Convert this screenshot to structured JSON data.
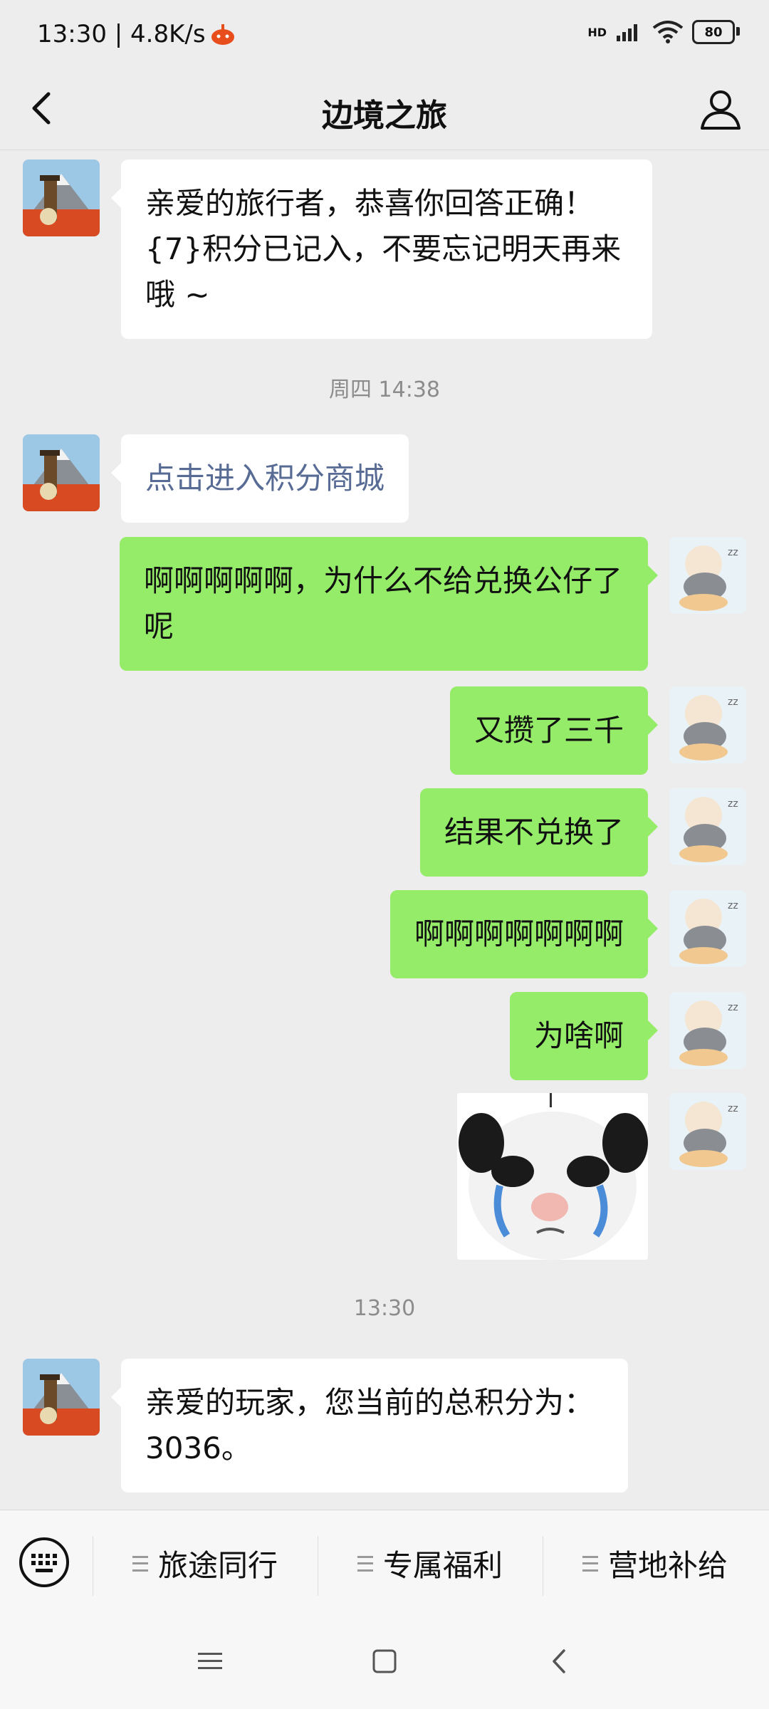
{
  "status_bar": {
    "time_speed": "13:30 | 4.8K/s",
    "network": "HD",
    "battery": "80"
  },
  "header": {
    "title": "边境之旅",
    "back_icon": "chevron-left-icon",
    "profile_icon": "person-icon"
  },
  "messages": {
    "m1": "亲爱的旅行者，恭喜你回答正确！{7}积分已记入，不要忘记明天再来哦 ~",
    "ts1": "周四 14:38",
    "m2_link": "点击进入积分商城",
    "m3": "啊啊啊啊啊，为什么不给兑换公仔了呢",
    "m4": "又攒了三千",
    "m5": "结果不兑换了",
    "m6": "啊啊啊啊啊啊啊",
    "m7": "为啥啊",
    "ts2": "13:30",
    "m9": "亲爱的玩家，您当前的总积分为：3036。"
  },
  "bottom_menu": {
    "keyboard_icon": "keyboard-icon",
    "items": [
      {
        "label": "旅途同行"
      },
      {
        "label": "专属福利"
      },
      {
        "label": "营地补给"
      }
    ]
  },
  "colors": {
    "background": "#ededed",
    "bubble_out": "#95ec69",
    "bubble_in": "#ffffff",
    "link": "#576b95"
  }
}
